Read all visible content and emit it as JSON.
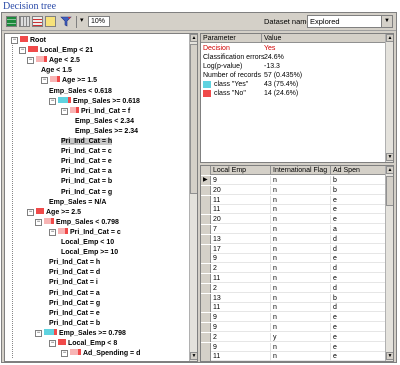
{
  "page_title": "Decision tree",
  "toolbar": {
    "zoom": "10%",
    "dataset_label": "Dataset name",
    "dataset_value": "Explored"
  },
  "tree": [
    {
      "label": "Root",
      "bar": "red",
      "bw": 8
    },
    {
      "label": "Local_Emp < 21",
      "bar": "red",
      "bw": 10
    },
    {
      "label": "Age < 2.5",
      "bar": "pink",
      "bw": 8
    },
    {
      "label": "Age < 1.5",
      "bar": "",
      "bw": 0
    },
    {
      "label": "Age >= 1.5",
      "bar": "pink",
      "bw": 7
    },
    {
      "label": "Emp_Sales < 0.618",
      "bar": "",
      "bw": 0
    },
    {
      "label": "Emp_Sales >= 0.618",
      "bar": "cyan",
      "bw": 10
    },
    {
      "label": "Pri_Ind_Cat = f",
      "bar": "pink",
      "bw": 6
    },
    {
      "label": "Emp_Sales < 2.34",
      "bar": "",
      "bw": 0
    },
    {
      "label": "Emp_Sales >= 2.34",
      "bar": "",
      "bw": 0
    },
    {
      "label": "Pri_Ind_Cat = h",
      "bar": "",
      "bw": 0
    },
    {
      "label": "Pri_Ind_Cat = c",
      "bar": "",
      "bw": 0
    },
    {
      "label": "Pri_Ind_Cat = e",
      "bar": "",
      "bw": 0
    },
    {
      "label": "Pri_Ind_Cat = a",
      "bar": "",
      "bw": 0
    },
    {
      "label": "Pri_Ind_Cat = b",
      "bar": "",
      "bw": 0
    },
    {
      "label": "Pri_Ind_Cat = g",
      "bar": "",
      "bw": 0
    },
    {
      "label": "Emp_Sales = N/A",
      "bar": "",
      "bw": 0
    },
    {
      "label": "Age >= 2.5",
      "bar": "red",
      "bw": 8
    },
    {
      "label": "Emp_Sales < 0.798",
      "bar": "pink",
      "bw": 7
    },
    {
      "label": "Pri_Ind_Cat = c",
      "bar": "pink",
      "bw": 7
    },
    {
      "label": "Local_Emp < 10",
      "bar": "",
      "bw": 0
    },
    {
      "label": "Local_Emp >= 10",
      "bar": "",
      "bw": 0
    },
    {
      "label": "Pri_Ind_Cat = h",
      "bar": "",
      "bw": 0
    },
    {
      "label": "Pri_Ind_Cat = d",
      "bar": "",
      "bw": 0
    },
    {
      "label": "Pri_Ind_Cat = i",
      "bar": "",
      "bw": 0
    },
    {
      "label": "Pri_Ind_Cat = a",
      "bar": "",
      "bw": 0
    },
    {
      "label": "Pri_Ind_Cat = g",
      "bar": "",
      "bw": 0
    },
    {
      "label": "Pri_Ind_Cat = e",
      "bar": "",
      "bw": 0
    },
    {
      "label": "Pri_Ind_Cat = b",
      "bar": "",
      "bw": 0
    },
    {
      "label": "Emp_Sales >= 0.798",
      "bar": "cyan",
      "bw": 10
    },
    {
      "label": "Local_Emp < 8",
      "bar": "red",
      "bw": 8
    },
    {
      "label": "Ad_Spending = d",
      "bar": "pink",
      "bw": 8
    }
  ],
  "params": {
    "headers": [
      "Parameter",
      "Value"
    ],
    "rows": [
      {
        "key": "Decision",
        "value": "Yes",
        "red": true
      },
      {
        "key": "Classification errors",
        "value": "24.6%"
      },
      {
        "key": "Log(p-value)",
        "value": "-13.3"
      },
      {
        "key": "Number of records",
        "value": "57 (0.435%)"
      },
      {
        "key": "class \"Yes\"",
        "value": "43 (75.4%)",
        "swatch": "#5fd3e0"
      },
      {
        "key": "class \"No\"",
        "value": "14 (24.6%)",
        "swatch": "#f04a4a"
      }
    ]
  },
  "records": {
    "headers": [
      "Local Emp",
      "International Flag",
      "Ad Spen"
    ],
    "rows": [
      [
        "9",
        "n",
        "b"
      ],
      [
        "20",
        "n",
        "b"
      ],
      [
        "11",
        "n",
        "e"
      ],
      [
        "11",
        "n",
        "e"
      ],
      [
        "20",
        "n",
        "e"
      ],
      [
        "7",
        "n",
        "a"
      ],
      [
        "13",
        "n",
        "d"
      ],
      [
        "17",
        "n",
        "d"
      ],
      [
        "9",
        "n",
        "e"
      ],
      [
        "2",
        "n",
        "d"
      ],
      [
        "11",
        "n",
        "e"
      ],
      [
        "2",
        "n",
        "d"
      ],
      [
        "13",
        "n",
        "b"
      ],
      [
        "11",
        "n",
        "d"
      ],
      [
        "9",
        "n",
        "e"
      ],
      [
        "9",
        "n",
        "e"
      ],
      [
        "2",
        "y",
        "e"
      ],
      [
        "9",
        "n",
        "e"
      ],
      [
        "11",
        "n",
        "e"
      ]
    ]
  }
}
